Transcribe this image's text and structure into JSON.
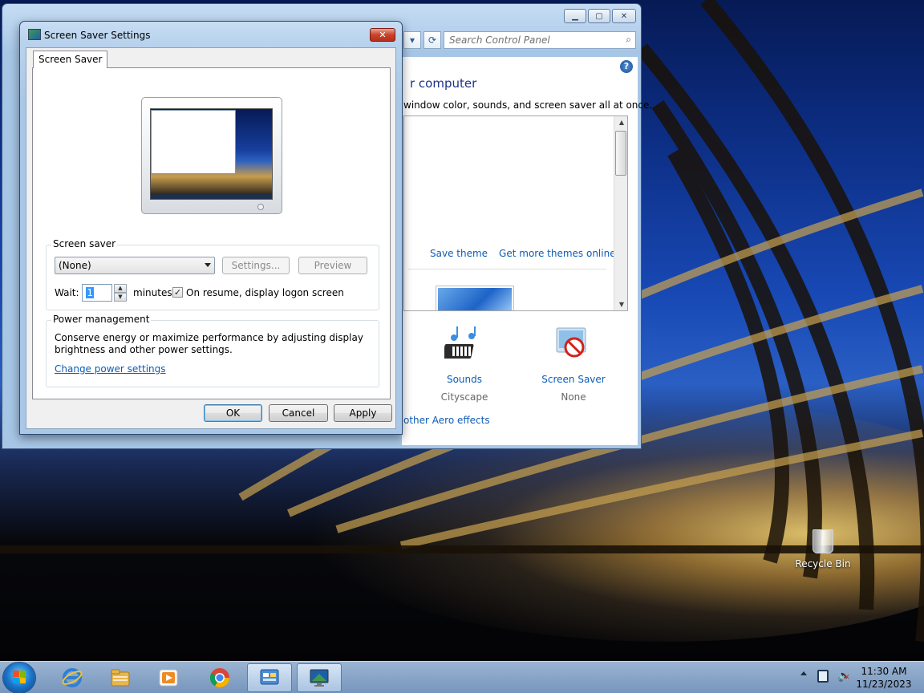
{
  "desktop": {
    "recycle_bin_label": "Recycle Bin"
  },
  "control_panel": {
    "search_placeholder": "Search Control Panel",
    "heading": "r computer",
    "subheading": "window color, sounds, and screen saver all at once.",
    "save_theme_link": "Save theme",
    "get_more_themes_link": "Get more themes online",
    "sounds": {
      "label": "Sounds",
      "value": "Cityscape"
    },
    "screen_saver": {
      "label": "Screen Saver",
      "value": "None"
    },
    "aero_link": "other Aero effects",
    "help_glyph": "?"
  },
  "dialog": {
    "title": "Screen Saver Settings",
    "close_glyph": "✕",
    "tab_label": "Screen Saver",
    "screensaver_group_label": "Screen saver",
    "screensaver_selected": "(None)",
    "settings_button": "Settings...",
    "preview_button": "Preview",
    "wait_label": "Wait:",
    "wait_value": "1",
    "minutes_label": "minutes",
    "logon_checked": true,
    "logon_label": "On resume, display logon screen",
    "power_group_label": "Power management",
    "power_text": "Conserve energy or maximize performance by adjusting display brightness and other power settings.",
    "power_link": "Change power settings",
    "ok_button": "OK",
    "cancel_button": "Cancel",
    "apply_button": "Apply"
  },
  "taskbar": {
    "pinned": [
      {
        "name": "internet-explorer-icon",
        "color": "#2e7fd8"
      },
      {
        "name": "file-explorer-icon",
        "color": "#e8b64a"
      },
      {
        "name": "media-player-icon",
        "color": "#f08a24"
      },
      {
        "name": "chrome-icon",
        "color": "#3aa757"
      },
      {
        "name": "control-panel-icon",
        "color": "#4a8cd6"
      },
      {
        "name": "screen-saver-settings-icon",
        "color": "#3f9b4f"
      }
    ],
    "time": "11:30 AM",
    "date": "11/23/2023"
  },
  "colors": {
    "link": "#0d5cb6",
    "accent": "#3399ff",
    "taskbar": "#8aa6c8",
    "close_red": "#c9432a"
  }
}
